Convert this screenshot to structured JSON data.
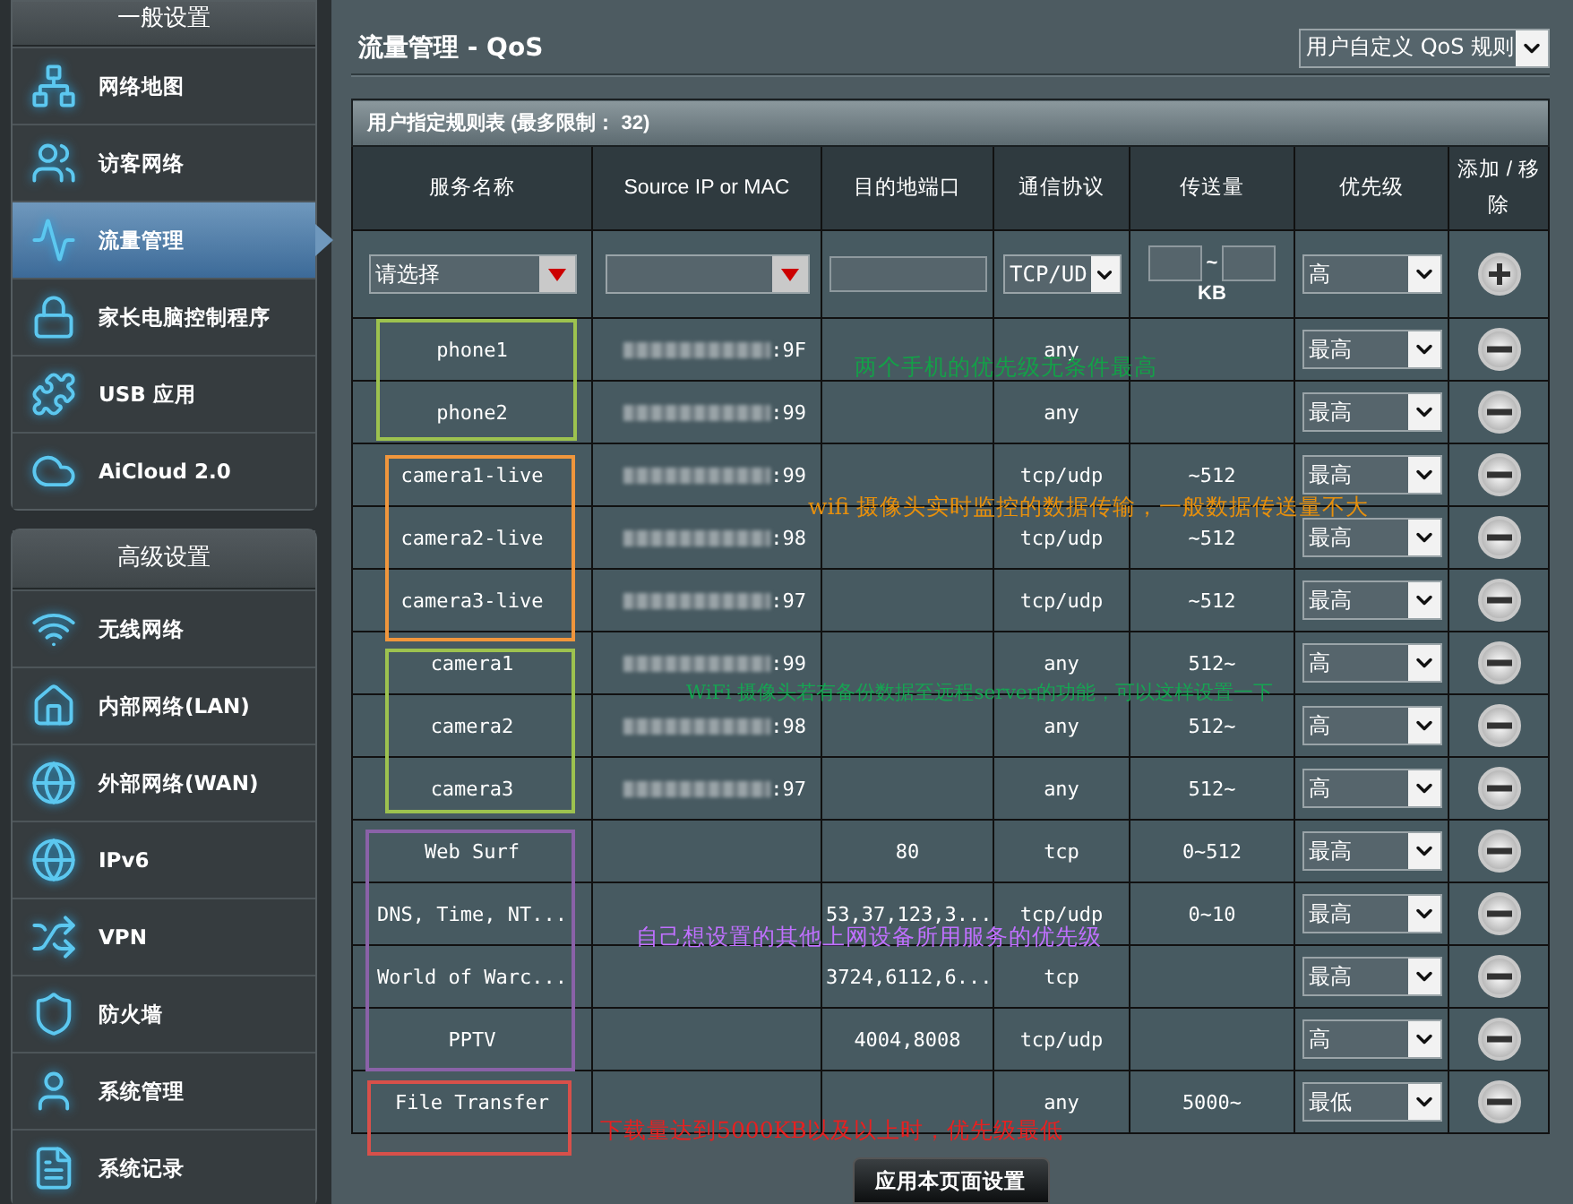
{
  "sidebar": {
    "sections": [
      {
        "title": "一般设置",
        "items": [
          {
            "label": "网络地图",
            "selected": false
          },
          {
            "label": "访客网络",
            "selected": false
          },
          {
            "label": "流量管理",
            "selected": true
          },
          {
            "label": "家长电脑控制程序",
            "selected": false
          },
          {
            "label": "USB 应用",
            "selected": false
          },
          {
            "label": "AiCloud 2.0",
            "selected": false
          }
        ]
      },
      {
        "title": "高级设置",
        "items": [
          {
            "label": "无线网络",
            "selected": false
          },
          {
            "label": "内部网络(LAN)",
            "selected": false
          },
          {
            "label": "外部网络(WAN)",
            "selected": false
          },
          {
            "label": "IPv6",
            "selected": false
          },
          {
            "label": "VPN",
            "selected": false
          },
          {
            "label": "防火墙",
            "selected": false
          },
          {
            "label": "系统管理",
            "selected": false
          },
          {
            "label": "系统记录",
            "selected": false
          }
        ]
      }
    ]
  },
  "page": {
    "title": "流量管理 - QoS",
    "mode_select": "用户自定义 QoS 规则"
  },
  "table": {
    "caption": "用户指定规则表 (最多限制： 32)",
    "columns": [
      "服务名称",
      "Source IP or MAC",
      "目的地端口",
      "通信协议",
      "传送量",
      "优先级",
      "添加 / 移除"
    ],
    "input_row": {
      "service": "请选择",
      "protocol": "TCP/UD",
      "amount_separator": "~",
      "amount_unit": "KB",
      "priority": "高"
    },
    "rows": [
      {
        "service": "phone1",
        "masked": true,
        "source": ":9F",
        "port": "",
        "protocol": "any",
        "amount": "",
        "priority": "最高"
      },
      {
        "service": "phone2",
        "masked": true,
        "source": ":99",
        "port": "",
        "protocol": "any",
        "amount": "",
        "priority": "最高"
      },
      {
        "service": "camera1-live",
        "masked": true,
        "source": ":99",
        "port": "",
        "protocol": "tcp/udp",
        "amount": "~512",
        "priority": "最高"
      },
      {
        "service": "camera2-live",
        "masked": true,
        "source": ":98",
        "port": "",
        "protocol": "tcp/udp",
        "amount": "~512",
        "priority": "最高"
      },
      {
        "service": "camera3-live",
        "masked": true,
        "source": ":97",
        "port": "",
        "protocol": "tcp/udp",
        "amount": "~512",
        "priority": "最高"
      },
      {
        "service": "camera1",
        "masked": true,
        "source": ":99",
        "port": "",
        "protocol": "any",
        "amount": "512~",
        "priority": "高"
      },
      {
        "service": "camera2",
        "masked": true,
        "source": ":98",
        "port": "",
        "protocol": "any",
        "amount": "512~",
        "priority": "高"
      },
      {
        "service": "camera3",
        "masked": true,
        "source": ":97",
        "port": "",
        "protocol": "any",
        "amount": "512~",
        "priority": "高"
      },
      {
        "service": "Web Surf",
        "masked": false,
        "source": "",
        "port": "80",
        "protocol": "tcp",
        "amount": "0~512",
        "priority": "最高"
      },
      {
        "service": "DNS, Time, NT...",
        "masked": false,
        "source": "",
        "port": "53,37,123,3...",
        "protocol": "tcp/udp",
        "amount": "0~10",
        "priority": "最高"
      },
      {
        "service": "World of Warc...",
        "masked": false,
        "source": "",
        "port": "3724,6112,6...",
        "protocol": "tcp",
        "amount": "",
        "priority": "最高"
      },
      {
        "service": "PPTV",
        "masked": false,
        "source": "",
        "port": "4004,8008",
        "protocol": "tcp/udp",
        "amount": "",
        "priority": "高"
      },
      {
        "service": "File Transfer",
        "masked": false,
        "source": "",
        "port": "",
        "protocol": "any",
        "amount": "5000~",
        "priority": "最低"
      }
    ]
  },
  "apply_button": "应用本页面设置",
  "highlight_boxes": [
    {
      "color": "#9dc24f"
    },
    {
      "color": "#f0963c"
    },
    {
      "color": "#9dc24f"
    },
    {
      "color": "#8a62a8"
    },
    {
      "color": "#d8504a"
    }
  ],
  "annotations": [
    {
      "text": "两个手机的优先级无条件最高",
      "color": "#14a048"
    },
    {
      "text": "wifi 摄像头实时监控的数据传输，一般数据传送量不大",
      "color": "#e8900c"
    },
    {
      "text": "WiFi 摄像头若有备份数据至远程server的功能，可以这样设置一下",
      "color": "#16a452"
    },
    {
      "text": "自己想设置的其他上网设备所用服务的优先级",
      "color": "#c070ff"
    },
    {
      "text": "下载量达到5000KB以及以上时，优先级最低",
      "color": "#e82020"
    }
  ]
}
